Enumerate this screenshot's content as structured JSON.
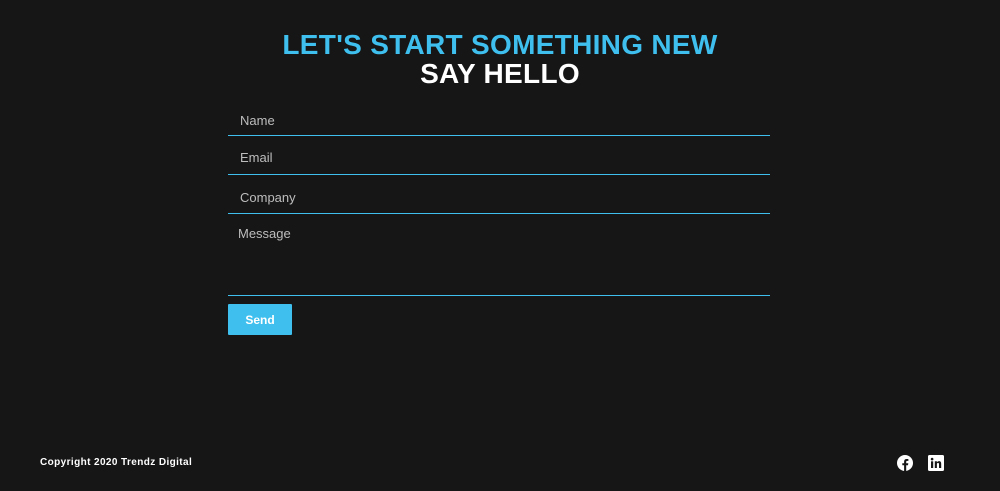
{
  "header": {
    "title": "LET'S START SOMETHING NEW",
    "subtitle": "SAY HELLO"
  },
  "form": {
    "name_placeholder": "Name",
    "email_placeholder": "Email",
    "company_placeholder": "Company",
    "message_placeholder": "Message",
    "send_label": "Send"
  },
  "footer": {
    "copyright": "Copyright 2020 Trendz Digital",
    "social": [
      {
        "icon": "facebook-icon"
      },
      {
        "icon": "linkedin-icon"
      }
    ]
  },
  "colors": {
    "background": "#161616",
    "accent": "#3ebfee",
    "text": "#ffffff"
  }
}
